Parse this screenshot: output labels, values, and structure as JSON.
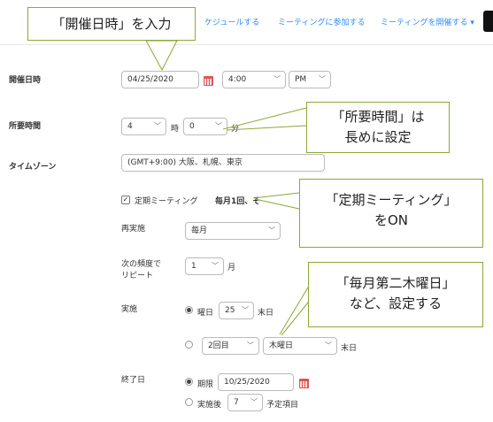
{
  "nav": {
    "schedule": "ケジュールする",
    "join": "ミーティングに参加する",
    "host": "ミーティングを開催する ▾"
  },
  "form": {
    "when_label": "開催日時",
    "date_value": "04/25/2020",
    "time_value": "4:00",
    "ampm_value": "PM",
    "duration_label": "所要時間",
    "duration_hours": "4",
    "hour_unit": "時",
    "duration_minutes": "0",
    "minute_unit": "分",
    "timezone_label": "タイムゾーン",
    "timezone_value": "(GMT+9:00) 大阪、札幌、東京",
    "recurring_label": "定期ミーティング",
    "recurring_summary": "毎月1回、そ",
    "recurrence_label": "再実施",
    "recurrence_value": "毎月",
    "repeat_every_label_line1": "次の頻度で",
    "repeat_every_label_line2": "リピート",
    "repeat_every_value": "1",
    "repeat_every_unit": "月",
    "occurs_on_label": "実施",
    "day_label": "曜日",
    "day_value": "25",
    "day_suffix": "末日",
    "week_value": "2回目",
    "weekday_value": "木曜日",
    "weekday_suffix": "末日",
    "end_date_label": "終了日",
    "end_by_label": "期限",
    "end_by_value": "10/25/2020",
    "end_after_label": "実施後",
    "end_after_value": "7",
    "end_after_suffix": "予定項目"
  },
  "callouts": {
    "datetime": "「開催日時」を入力",
    "duration_line1": "「所要時間」は",
    "duration_line2": "長めに設定",
    "recurring_line1": "「定期ミーティング」",
    "recurring_line2": "をON",
    "monthly_line1": "「毎月第二木曜日」",
    "monthly_line2": "など、設定する"
  },
  "colors": {
    "accent_blue": "#2d8cff",
    "callout_border": "#8aaa35",
    "calendar_red": "#e05555"
  }
}
